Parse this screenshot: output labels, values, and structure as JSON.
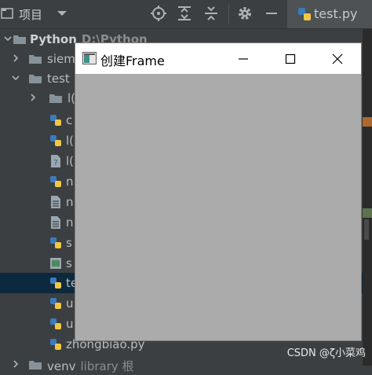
{
  "toolbar": {
    "project_label": "项目",
    "icons": [
      "dropdown-arrow-icon",
      "locate-target-icon",
      "expand-all-icon",
      "collapse-all-icon",
      "gear-icon",
      "minimize-panel-icon"
    ]
  },
  "editor_tab": {
    "label": "test.py",
    "icon": "python-file-icon"
  },
  "tree": {
    "root": {
      "name": "Python",
      "path": "D:\\Python"
    },
    "items": [
      {
        "label": "siem",
        "kind": "folder",
        "expanded": false
      },
      {
        "label": "test",
        "kind": "folder",
        "expanded": true
      },
      {
        "label": "l(",
        "kind": "folder",
        "expanded": false
      },
      {
        "label": "c",
        "kind": "python-file"
      },
      {
        "label": "l(",
        "kind": "python-file"
      },
      {
        "label": "l(",
        "kind": "unknown-file"
      },
      {
        "label": "n",
        "kind": "python-file"
      },
      {
        "label": "n",
        "kind": "text-file"
      },
      {
        "label": "n",
        "kind": "text-file"
      },
      {
        "label": "s",
        "kind": "python-file"
      },
      {
        "label": "s",
        "kind": "image-file"
      },
      {
        "label": "te",
        "kind": "python-file",
        "selected": true
      },
      {
        "label": "u",
        "kind": "python-file"
      },
      {
        "label": "u",
        "kind": "python-file"
      },
      {
        "label": "zhongbiao.py",
        "kind": "python-file"
      },
      {
        "label": "venv",
        "sublabel": "library 根",
        "kind": "folder",
        "expanded": false
      }
    ]
  },
  "frame_window": {
    "title": "创建Frame",
    "controls": [
      "minimize-icon",
      "maximize-icon",
      "close-icon"
    ],
    "client_color": "#ababab"
  },
  "watermark": "CSDN @ζ小菜鸡",
  "colors": {
    "ide_bg": "#3c3f41",
    "selection": "#0d293e",
    "python_blue": "#3b7bbf",
    "python_yellow": "#f2c744"
  }
}
